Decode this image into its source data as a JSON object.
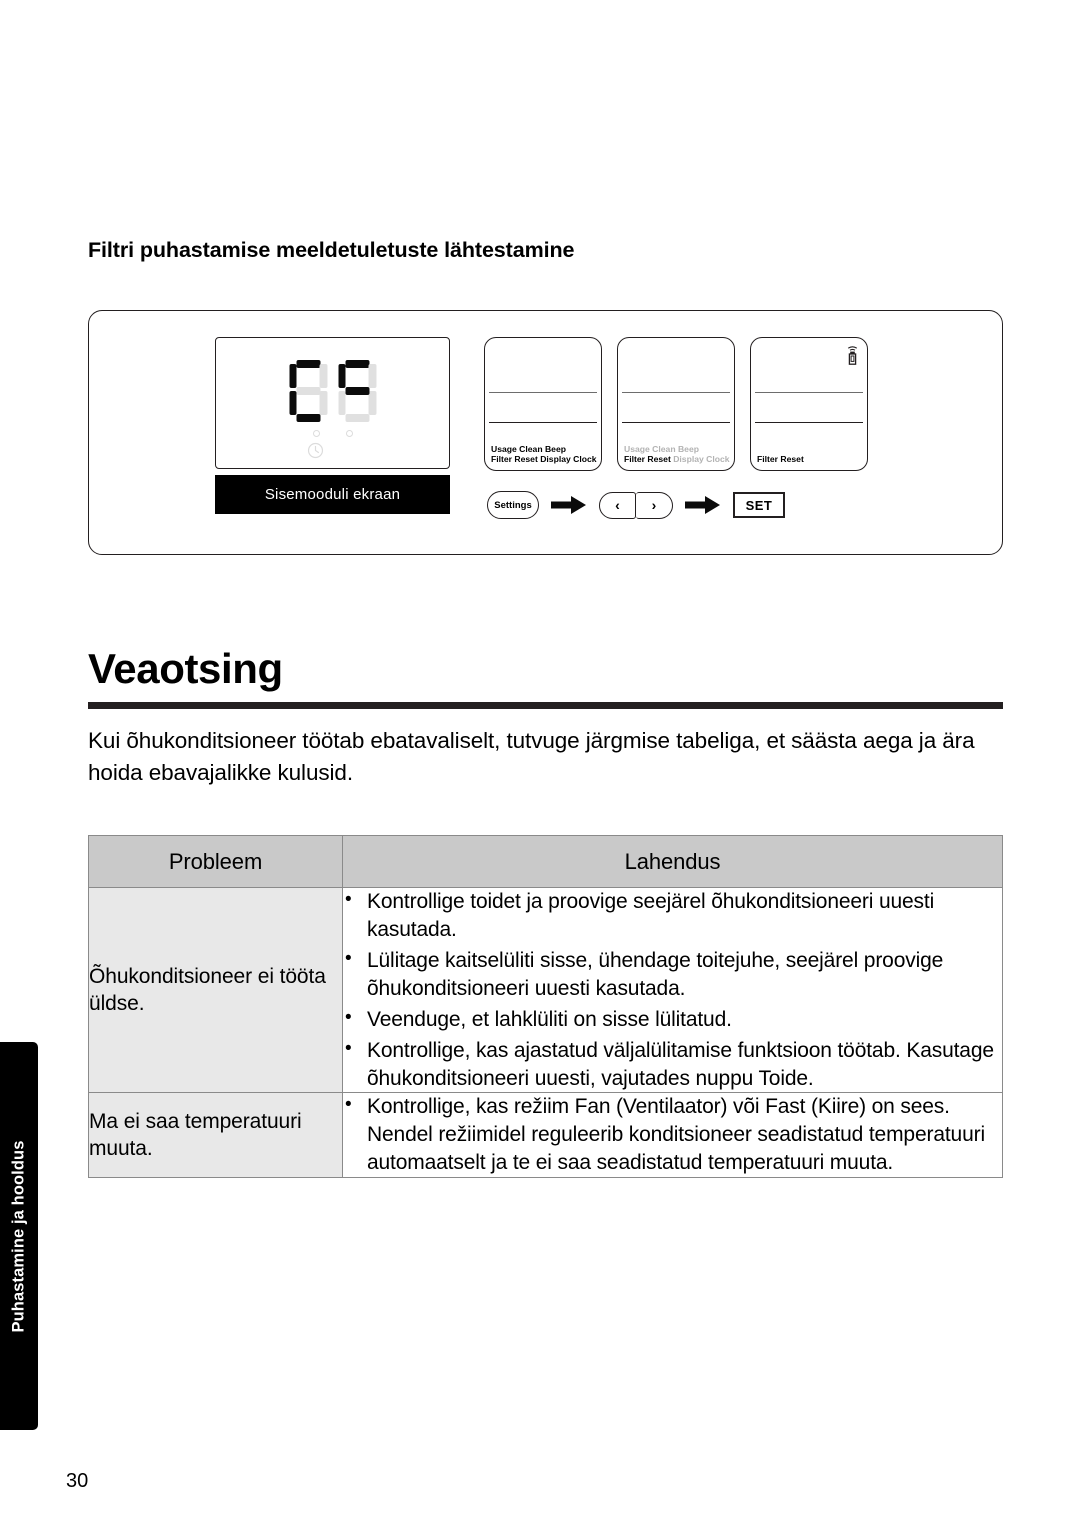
{
  "side_tab": {
    "label": "Puhastamine ja hooldus"
  },
  "section": {
    "title": "Filtri puhastamise meeldetuletuste lähtestamine"
  },
  "figure": {
    "display": {
      "segment_text": "CF",
      "caption": "Sisemooduli ekraan",
      "clock_icon": "clock-icon",
      "led_icons": [
        "led-indicator-left",
        "led-indicator-right"
      ]
    },
    "panels": [
      {
        "id": "panel-1",
        "line1": "Usage Clean Beep",
        "line2": "Filter Reset Display Clock",
        "line1_state": "on",
        "line2_state": "on",
        "highlight": ""
      },
      {
        "id": "panel-2",
        "line1": "Usage Clean Beep",
        "line2_highlight": "Filter Reset",
        "line2_rest": " Display Clock",
        "line1_state": "dim",
        "highlight": "Filter Reset"
      },
      {
        "id": "panel-3",
        "line2": "Filter Reset",
        "remote_icon": "remote-signal-icon"
      }
    ],
    "flow": {
      "settings_label": "Settings",
      "nav_left": "‹",
      "nav_right": "›",
      "set_label": "SET",
      "arrow_icon": "right-arrow-icon"
    }
  },
  "chapter": {
    "title": "Veaotsing",
    "intro": "Kui õhukonditsioneer töötab ebatavaliselt, tutvuge järgmise tabeliga, et säästa aega ja ära hoida ebavajalikke kulusid."
  },
  "table": {
    "headers": {
      "problem": "Probleem",
      "solution": "Lahendus"
    },
    "rows": [
      {
        "problem": "Õhukonditsioneer ei tööta üldse.",
        "solutions": [
          "Kontrollige toidet ja proovige seejärel õhukonditsioneeri uuesti kasutada.",
          "Lülitage kaitselüliti sisse, ühendage toitejuhe, seejärel proovige õhukonditsioneeri uuesti kasutada.",
          "Veenduge, et lahklüliti on sisse lülitatud.",
          "Kontrollige, kas ajastatud väljalülitamise funktsioon töötab. Kasutage õhukonditsioneeri uuesti, vajutades nuppu Toide."
        ]
      },
      {
        "problem": "Ma ei saa temperatuuri muuta.",
        "solutions": [
          "Kontrollige, kas režiim Fan (Ventilaator) või Fast (Kiire) on sees. Nendel režiimidel reguleerib konditsioneer seadistatud temperatuuri automaatselt ja te ei saa seadistatud temperatuuri muuta."
        ]
      }
    ]
  },
  "page": {
    "number": "30"
  },
  "colors": {
    "ink": "#231f20",
    "header_fill": "#c9c9c9",
    "problem_fill": "#e8e8e8",
    "segment_on": "#0b0b0b",
    "segment_off": "#e0e0e0",
    "dim_text": "#b3b3b3"
  }
}
